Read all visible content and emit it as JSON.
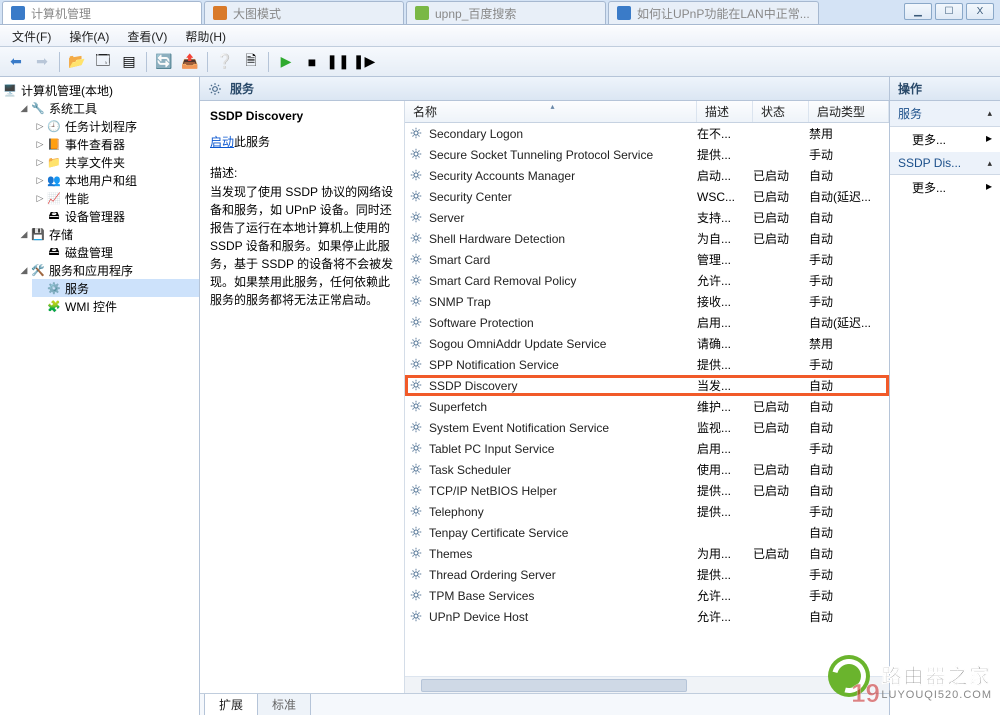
{
  "browser_tabs": [
    {
      "favicon_color": "#3a7bc8",
      "label": "计算机管理"
    },
    {
      "favicon_color": "#d97a2a",
      "label": "大图模式"
    },
    {
      "favicon_color": "#7ab846",
      "label": "upnp_百度搜索"
    },
    {
      "favicon_color": "#3a7bc8",
      "label": "如何让UPnP功能在LAN中正常..."
    }
  ],
  "win_buttons": {
    "min": "▁",
    "max": "☐",
    "close": "X"
  },
  "menu": [
    "文件(F)",
    "操作(A)",
    "查看(V)",
    "帮助(H)"
  ],
  "tree_root": "计算机管理(本地)",
  "tree": {
    "sys_tools": "系统工具",
    "sys_children": [
      "任务计划程序",
      "事件查看器",
      "共享文件夹",
      "本地用户和组",
      "性能",
      "设备管理器"
    ],
    "storage": "存储",
    "storage_children": [
      "磁盘管理"
    ],
    "services_apps": "服务和应用程序",
    "services_children": [
      "服务",
      "WMI 控件"
    ]
  },
  "tree_icons": {
    "root": "🖥️",
    "sys_tools": "🔧",
    "task": "🕘",
    "event": "📙",
    "share": "📁",
    "users": "👥",
    "perf": "📈",
    "devmgr": "🖴",
    "storage": "💾",
    "disk": "🖴",
    "svcapps": "🛠️",
    "services": "⚙️",
    "wmi": "🧩"
  },
  "services_title": "服务",
  "desc_panel": {
    "name": "SSDP Discovery",
    "start_link_a": "启动",
    "start_link_b": "此服务",
    "desc_label": "描述:",
    "desc_text": "当发现了使用 SSDP 协议的网络设备和服务，如 UPnP 设备。同时还报告了运行在本地计算机上使用的 SSDP 设备和服务。如果停止此服务，基于 SSDP 的设备将不会被发现。如果禁用此服务，任何依赖此服务的服务都将无法正常启动。"
  },
  "columns": {
    "name": "名称",
    "desc": "描述",
    "state": "状态",
    "start": "启动类型"
  },
  "services": [
    {
      "name": "Secondary Logon",
      "desc": "在不...",
      "state": "",
      "start": "禁用"
    },
    {
      "name": "Secure Socket Tunneling Protocol Service",
      "desc": "提供...",
      "state": "",
      "start": "手动"
    },
    {
      "name": "Security Accounts Manager",
      "desc": "启动...",
      "state": "已启动",
      "start": "自动"
    },
    {
      "name": "Security Center",
      "desc": "WSC...",
      "state": "已启动",
      "start": "自动(延迟..."
    },
    {
      "name": "Server",
      "desc": "支持...",
      "state": "已启动",
      "start": "自动"
    },
    {
      "name": "Shell Hardware Detection",
      "desc": "为自...",
      "state": "已启动",
      "start": "自动"
    },
    {
      "name": "Smart Card",
      "desc": "管理...",
      "state": "",
      "start": "手动"
    },
    {
      "name": "Smart Card Removal Policy",
      "desc": "允许...",
      "state": "",
      "start": "手动"
    },
    {
      "name": "SNMP Trap",
      "desc": "接收...",
      "state": "",
      "start": "手动"
    },
    {
      "name": "Software Protection",
      "desc": "启用...",
      "state": "",
      "start": "自动(延迟..."
    },
    {
      "name": "Sogou OmniAddr Update Service",
      "desc": "请确...",
      "state": "",
      "start": "禁用"
    },
    {
      "name": "SPP Notification Service",
      "desc": "提供...",
      "state": "",
      "start": "手动"
    },
    {
      "name": "SSDP Discovery",
      "desc": "当发...",
      "state": "",
      "start": "自动",
      "hl": true
    },
    {
      "name": "Superfetch",
      "desc": "维护...",
      "state": "已启动",
      "start": "自动"
    },
    {
      "name": "System Event Notification Service",
      "desc": "监视...",
      "state": "已启动",
      "start": "自动"
    },
    {
      "name": "Tablet PC Input Service",
      "desc": "启用...",
      "state": "",
      "start": "手动"
    },
    {
      "name": "Task Scheduler",
      "desc": "使用...",
      "state": "已启动",
      "start": "自动"
    },
    {
      "name": "TCP/IP NetBIOS Helper",
      "desc": "提供...",
      "state": "已启动",
      "start": "自动"
    },
    {
      "name": "Telephony",
      "desc": "提供...",
      "state": "",
      "start": "手动"
    },
    {
      "name": "Tenpay Certificate Service",
      "desc": "",
      "state": "",
      "start": "自动"
    },
    {
      "name": "Themes",
      "desc": "为用...",
      "state": "已启动",
      "start": "自动"
    },
    {
      "name": "Thread Ordering Server",
      "desc": "提供...",
      "state": "",
      "start": "手动"
    },
    {
      "name": "TPM Base Services",
      "desc": "允许...",
      "state": "",
      "start": "手动"
    },
    {
      "name": "UPnP Device Host",
      "desc": "允许...",
      "state": "",
      "start": "自动"
    }
  ],
  "bottom_tabs": {
    "ext": "扩展",
    "std": "标准"
  },
  "right": {
    "header": "操作",
    "sec1": "服务",
    "more": "更多...",
    "sec2": "SSDP Dis..."
  },
  "watermark": {
    "top": "路由器之家",
    "bottom": "LUYOUQI520.COM",
    "num": "19"
  }
}
